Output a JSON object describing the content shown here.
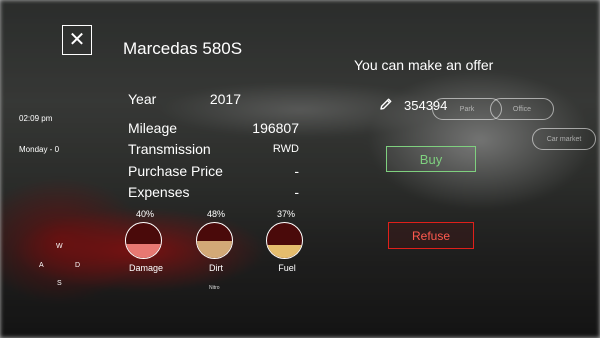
{
  "car": {
    "title": "Marcedas 580S",
    "year_label": "Year",
    "year_value": "2017",
    "mileage_label": "Mileage",
    "mileage_value": "196807",
    "transmission_label": "Transmission",
    "transmission_value": "RWD",
    "purchase_price_label": "Purchase Price",
    "purchase_price_value": "-",
    "expenses_label": "Expenses",
    "expenses_value": "-"
  },
  "gauges": [
    {
      "label": "Damage",
      "percent_text": "40%",
      "level": 0.4,
      "fill_color": "#e77872"
    },
    {
      "label": "Dirt",
      "percent_text": "48%",
      "level": 0.48,
      "fill_color": "#d2a977"
    },
    {
      "label": "Fuel",
      "percent_text": "37%",
      "level": 0.37,
      "fill_color": "#e5bd6d"
    }
  ],
  "hud": {
    "time": "02:09 pm",
    "day": "Monday - 0",
    "compass": {
      "w": "W",
      "a": "A",
      "d": "D",
      "s": "S"
    },
    "nitro": "Nitro"
  },
  "offer": {
    "title": "You can make an offer",
    "amount": "354394",
    "buy_label": "Buy",
    "refuse_label": "Refuse"
  },
  "background_buttons": {
    "pill1": "Park",
    "pill2": "Office",
    "pill3": "Car market"
  },
  "colors": {
    "buy_accent": "#7fd07f",
    "refuse_accent": "#e0201a",
    "gauge_empty": "#4a0a0a"
  }
}
